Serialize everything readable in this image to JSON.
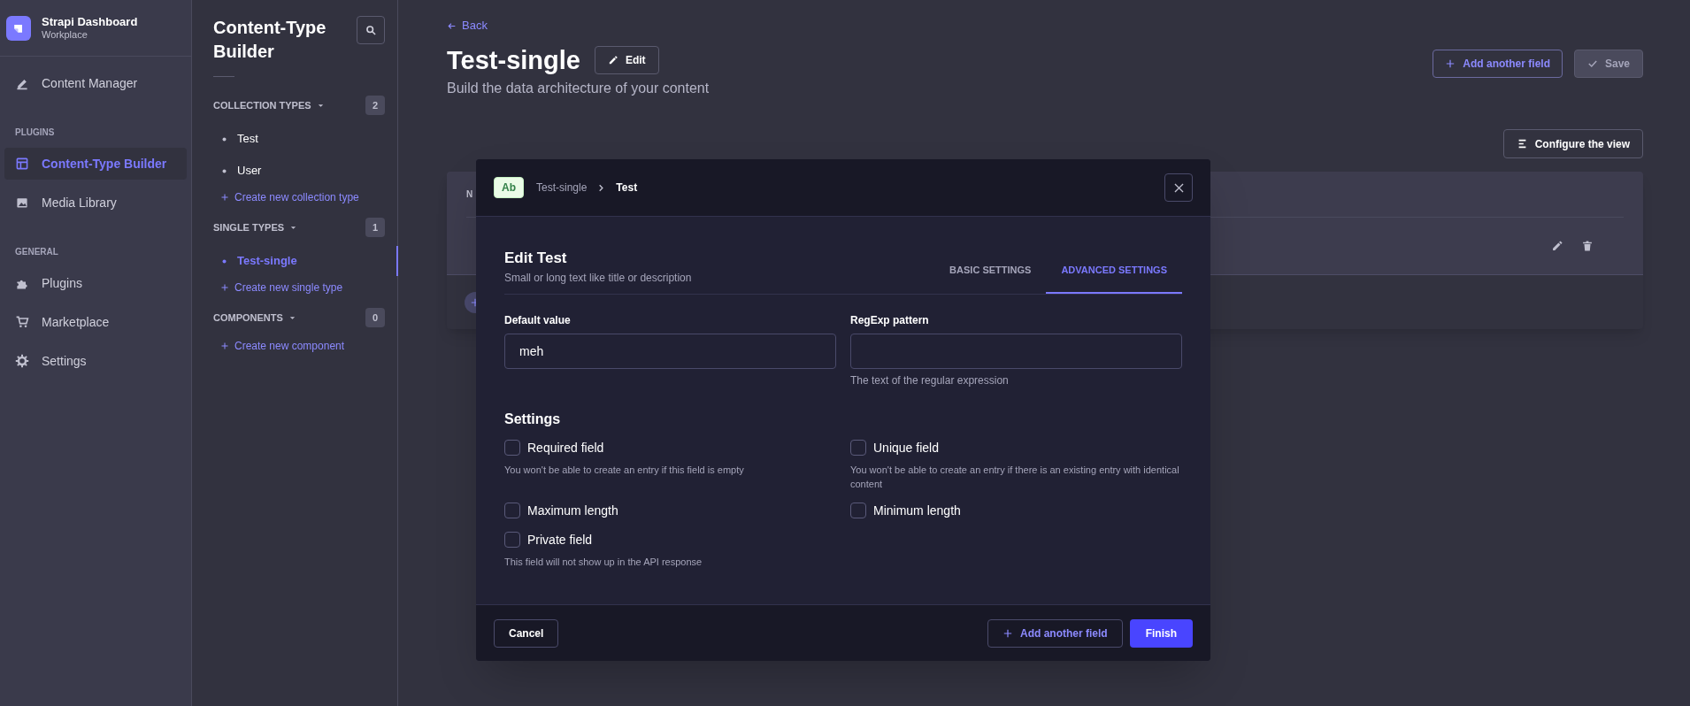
{
  "brand": {
    "title": "Strapi Dashboard",
    "subtitle": "Workplace"
  },
  "nav": [
    {
      "kind": "item",
      "label": "Content Manager",
      "selected": false
    },
    {
      "kind": "section",
      "label": "PLUGINS"
    },
    {
      "kind": "item",
      "label": "Content-Type Builder",
      "selected": true
    },
    {
      "kind": "item",
      "label": "Media Library",
      "selected": false
    },
    {
      "kind": "section",
      "label": "GENERAL"
    },
    {
      "kind": "item",
      "label": "Plugins",
      "selected": false
    },
    {
      "kind": "item",
      "label": "Marketplace",
      "selected": false
    },
    {
      "kind": "item",
      "label": "Settings",
      "selected": false
    }
  ],
  "builder": {
    "title": "Content-Type Builder",
    "groups": [
      {
        "label": "COLLECTION TYPES",
        "count": "2",
        "items": [
          {
            "label": "Test",
            "selected": false
          },
          {
            "label": "User",
            "selected": false
          }
        ],
        "create": "Create new collection type"
      },
      {
        "label": "SINGLE TYPES",
        "count": "1",
        "items": [
          {
            "label": "Test-single",
            "selected": true
          }
        ],
        "create": "Create new single type"
      },
      {
        "label": "COMPONENTS",
        "count": "0",
        "create": "Create new component"
      }
    ]
  },
  "header": {
    "back": "Back",
    "title": "Test-single",
    "edit": "Edit",
    "subtitle": "Build the data architecture of your content",
    "add_field": "Add another field",
    "save": "Save",
    "configure": "Configure the view"
  },
  "table": {
    "column_1": "N"
  },
  "modal": {
    "badge": "Ab",
    "breadcrumb": [
      "Test-single",
      "Test"
    ],
    "title": "Edit Test",
    "subtitle": "Small or long text like title or description",
    "tabs": [
      {
        "label": "BASIC SETTINGS",
        "selected": false
      },
      {
        "label": "ADVANCED SETTINGS",
        "selected": true
      }
    ],
    "fields": [
      {
        "label": "Default value",
        "value": "meh"
      },
      {
        "label": "RegExp pattern",
        "hint": "The text of the regular expression"
      }
    ],
    "settings_title": "Settings",
    "options": [
      {
        "label": "Required field",
        "checked": false,
        "hint": "You won't be able to create an entry if this field is empty"
      },
      {
        "label": "Unique field",
        "checked": false,
        "hint": "You won't be able to create an entry if there is an existing entry with identical content"
      },
      {
        "label": "Maximum length",
        "checked": false
      },
      {
        "label": "Minimum length",
        "checked": false
      },
      {
        "label": "Private field",
        "checked": false,
        "hint": "This field will not show up in the API response"
      }
    ],
    "cancel": "Cancel",
    "add_field": "Add another field",
    "finish": "Finish"
  }
}
